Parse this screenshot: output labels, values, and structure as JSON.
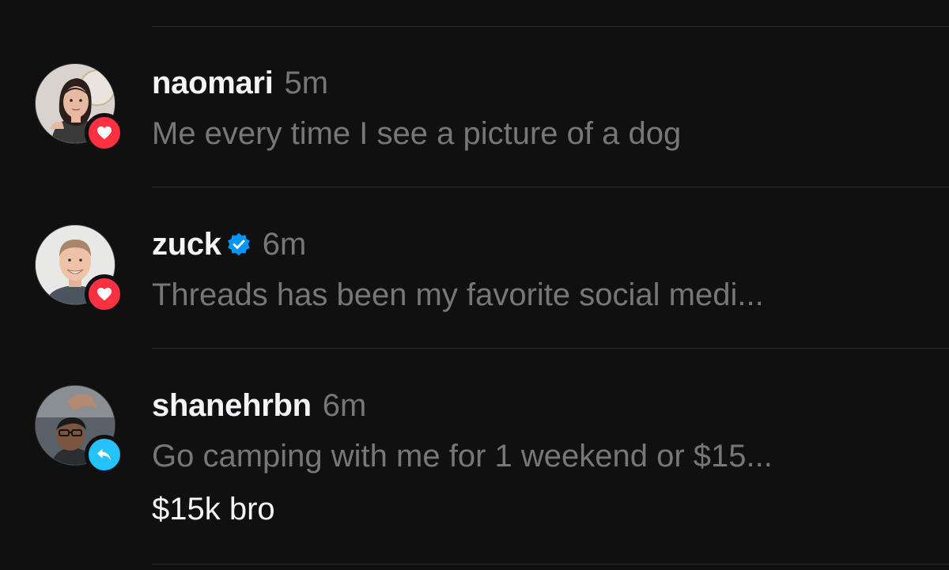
{
  "colors": {
    "background": "#101010",
    "divider": "#2a2a2a",
    "secondary_text": "#777777",
    "primary_text": "#f3f5f7",
    "like_badge": "#ff3040",
    "reply_badge": "#24c3ff",
    "verified": "#0095f6"
  },
  "activity": [
    {
      "username": "naomari",
      "time": "5m",
      "verified": false,
      "badge_icon": "heart-icon",
      "text": "Me every time I see a picture of a dog"
    },
    {
      "username": "zuck",
      "time": "6m",
      "verified": true,
      "badge_icon": "heart-icon",
      "text": "Threads has been my favorite social medi..."
    },
    {
      "username": "shanehrbn",
      "time": "6m",
      "verified": false,
      "badge_icon": "reply-arrow-icon",
      "text": "Go camping with me for 1 weekend or $15...",
      "reply": "$15k bro"
    }
  ]
}
